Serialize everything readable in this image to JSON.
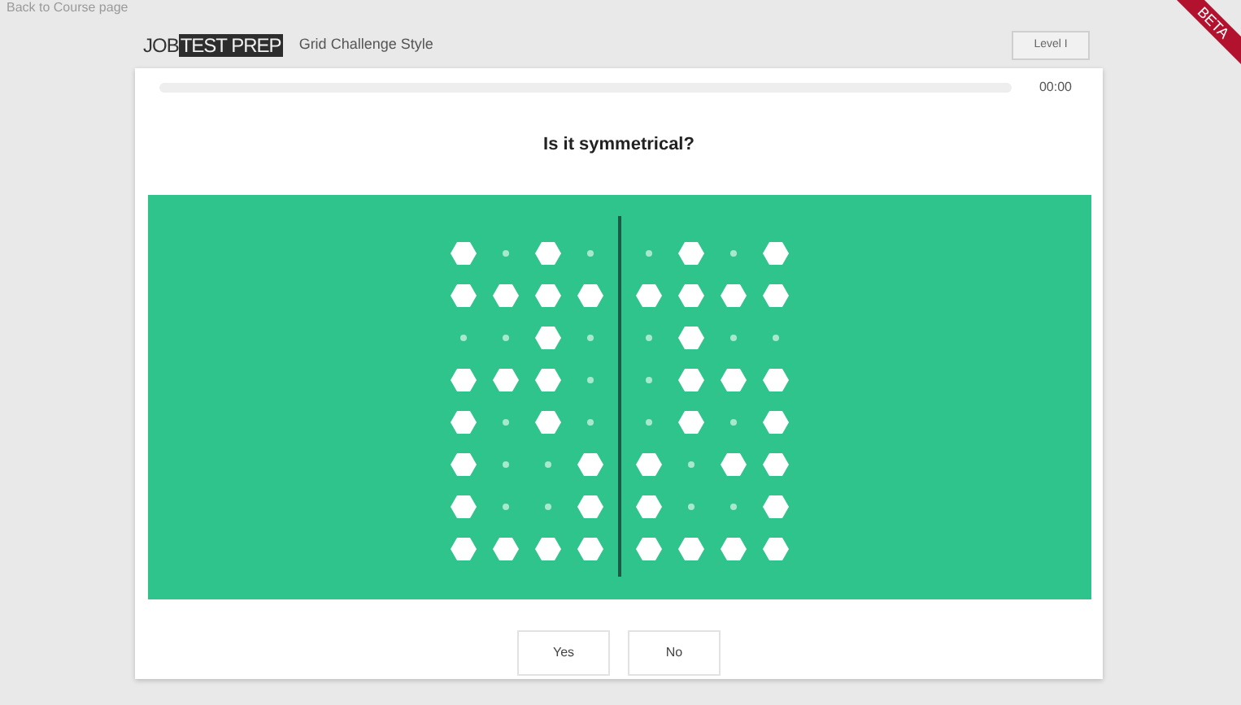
{
  "back_link": "Back to Course page",
  "header": {
    "logo_left": "JOB",
    "logo_right": "TEST PREP",
    "title": "Grid Challenge Style",
    "level_button": "Level I"
  },
  "ribbon": "BETA",
  "progress": {
    "timer": "00:00"
  },
  "question": "Is it symmetrical?",
  "left_grid": [
    [
      true,
      false,
      true,
      false
    ],
    [
      true,
      true,
      true,
      true
    ],
    [
      false,
      false,
      true,
      false
    ],
    [
      true,
      true,
      true,
      false
    ],
    [
      true,
      false,
      true,
      false
    ],
    [
      true,
      false,
      false,
      true
    ],
    [
      true,
      false,
      false,
      true
    ],
    [
      true,
      true,
      true,
      true
    ]
  ],
  "right_grid": [
    [
      false,
      true,
      false,
      true
    ],
    [
      true,
      true,
      true,
      true
    ],
    [
      false,
      true,
      false,
      false
    ],
    [
      false,
      true,
      true,
      true
    ],
    [
      false,
      true,
      false,
      true
    ],
    [
      true,
      false,
      true,
      true
    ],
    [
      true,
      false,
      false,
      true
    ],
    [
      true,
      true,
      true,
      true
    ]
  ],
  "answers": [
    "Yes",
    "No"
  ]
}
